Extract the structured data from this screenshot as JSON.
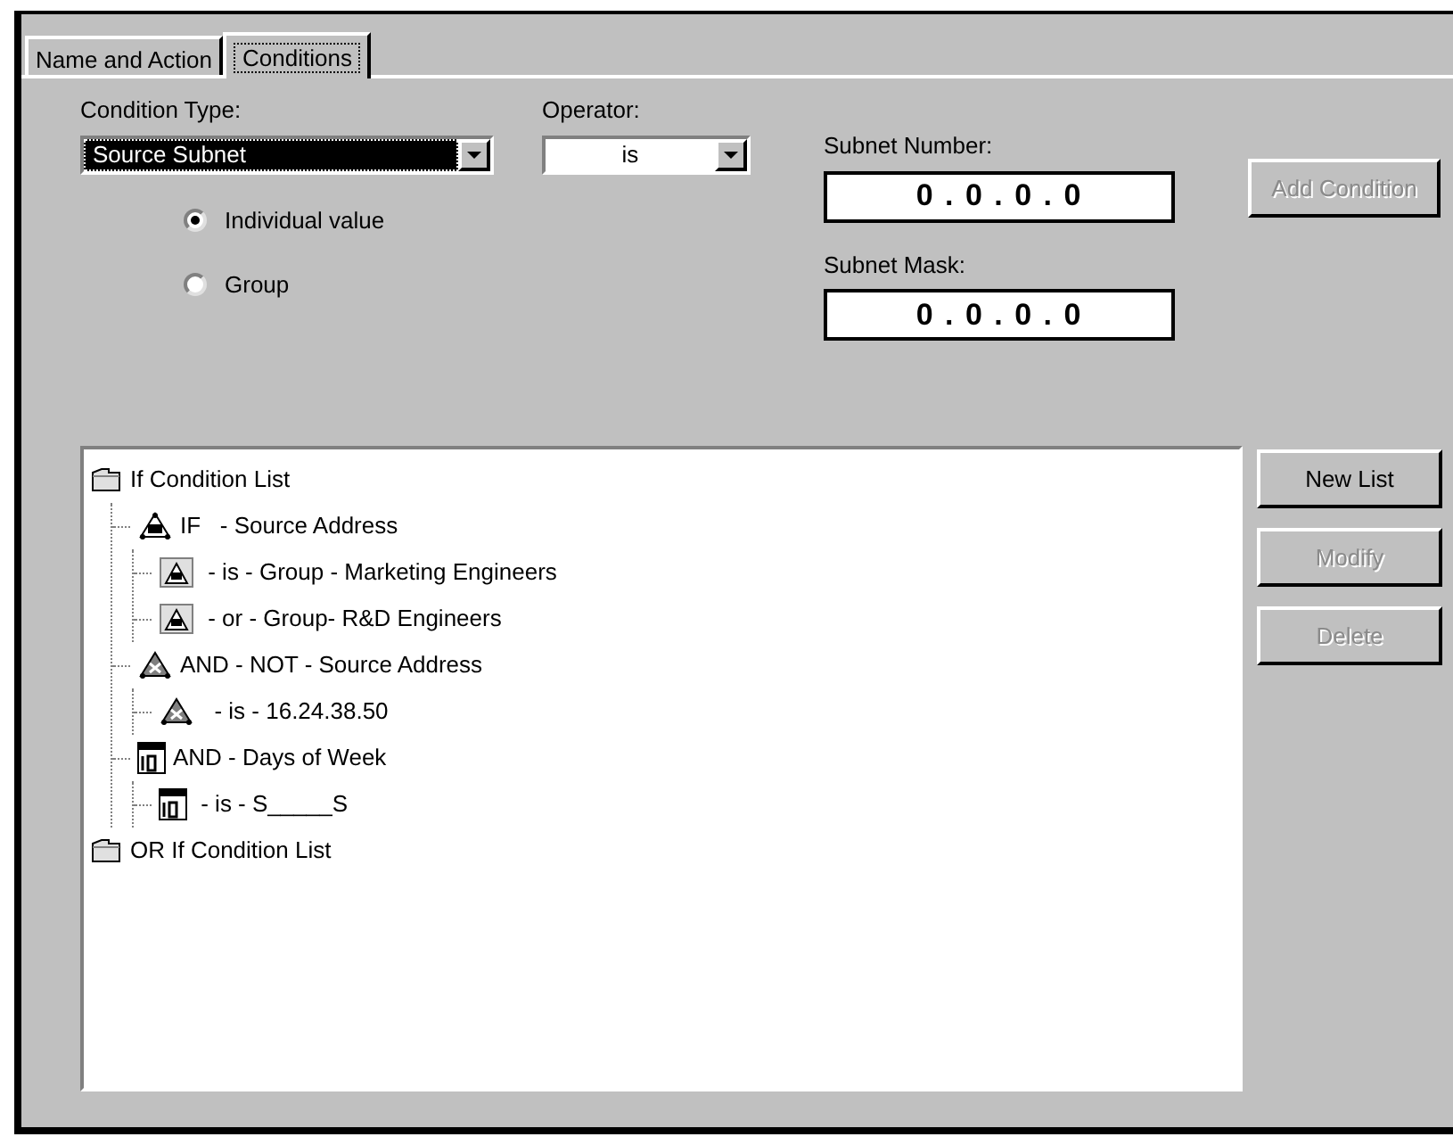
{
  "tabs": [
    {
      "label": "Name and Action",
      "selected": false
    },
    {
      "label": "Conditions",
      "selected": true
    }
  ],
  "condition_type": {
    "label": "Condition Type:",
    "value": "Source Subnet"
  },
  "operator": {
    "label": "Operator:",
    "value": "is"
  },
  "value_mode": [
    {
      "label": "Individual value",
      "selected": true
    },
    {
      "label": "Group",
      "selected": false
    }
  ],
  "subnet_number": {
    "label": "Subnet Number:",
    "value": "0 . 0 . 0 . 0"
  },
  "subnet_mask": {
    "label": "Subnet Mask:",
    "value": "0 . 0 . 0 . 0"
  },
  "add_condition": {
    "label": "Add Condition",
    "disabled": true
  },
  "tree": [
    {
      "kind": "folder",
      "label": "If Condition List",
      "children": [
        {
          "kind": "ip",
          "label": "IF   - Source Address",
          "children": [
            {
              "kind": "group",
              "label": " - is - Group - Marketing Engineers"
            },
            {
              "kind": "group",
              "label": " - or - Group- R&D Engineers"
            }
          ]
        },
        {
          "kind": "network",
          "label": "AND - NOT - Source Address",
          "children": [
            {
              "kind": "network",
              "label": "  - is - 16.24.38.50"
            }
          ]
        },
        {
          "kind": "calendar",
          "label": "AND - Days of Week",
          "children": [
            {
              "kind": "calendar",
              "label": " - is - S_____S"
            }
          ]
        }
      ]
    },
    {
      "kind": "folder",
      "label": "OR If Condition List"
    }
  ],
  "list_buttons": [
    {
      "label": "New List",
      "disabled": false
    },
    {
      "label": "Modify",
      "disabled": true
    },
    {
      "label": "Delete",
      "disabled": true
    }
  ]
}
